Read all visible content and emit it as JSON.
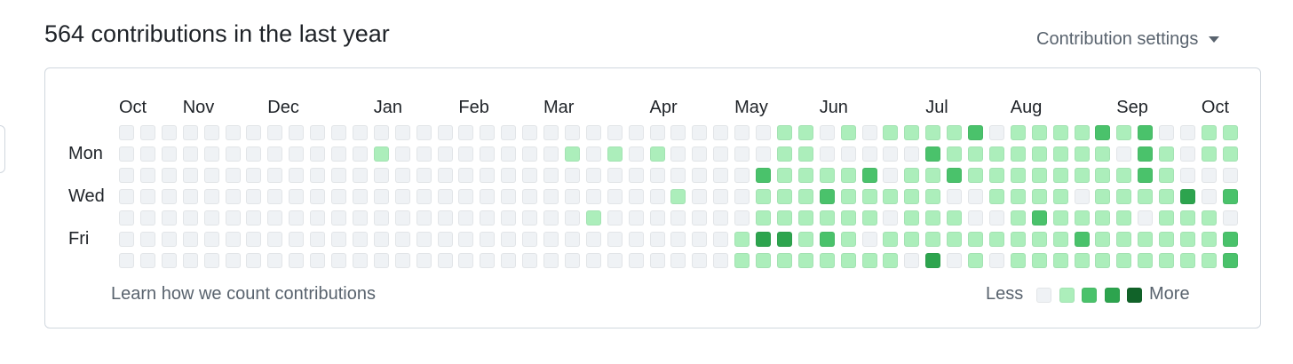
{
  "header": {
    "title": "564 contributions in the last year",
    "settings_label": "Contribution settings",
    "settings_icon": "triangle-down-icon"
  },
  "calendar": {
    "months": [
      "Oct",
      "Nov",
      "Dec",
      "Jan",
      "Feb",
      "Mar",
      "Apr",
      "May",
      "Jun",
      "Jul",
      "Aug",
      "Sep",
      "Oct"
    ],
    "month_week_index": [
      0,
      3,
      7,
      12,
      16,
      20,
      25,
      29,
      33,
      38,
      42,
      47,
      51
    ],
    "day_labels": [
      {
        "label": "Mon",
        "row": 1
      },
      {
        "label": "Wed",
        "row": 3
      },
      {
        "label": "Fri",
        "row": 5
      }
    ],
    "level_colors": [
      "#eff2f5",
      "#aceebb",
      "#4ac26b",
      "#2da44e",
      "#116329"
    ],
    "weeks": [
      [
        0,
        0,
        0,
        0,
        0,
        0,
        0
      ],
      [
        0,
        0,
        0,
        0,
        0,
        0,
        0
      ],
      [
        0,
        0,
        0,
        0,
        0,
        0,
        0
      ],
      [
        0,
        0,
        0,
        0,
        0,
        0,
        0
      ],
      [
        0,
        0,
        0,
        0,
        0,
        0,
        0
      ],
      [
        0,
        0,
        0,
        0,
        0,
        0,
        0
      ],
      [
        0,
        0,
        0,
        0,
        0,
        0,
        0
      ],
      [
        0,
        0,
        0,
        0,
        0,
        0,
        0
      ],
      [
        0,
        0,
        0,
        0,
        0,
        0,
        0
      ],
      [
        0,
        0,
        0,
        0,
        0,
        0,
        0
      ],
      [
        0,
        0,
        0,
        0,
        0,
        0,
        0
      ],
      [
        0,
        0,
        0,
        0,
        0,
        0,
        0
      ],
      [
        0,
        1,
        0,
        0,
        0,
        0,
        0
      ],
      [
        0,
        0,
        0,
        0,
        0,
        0,
        0
      ],
      [
        0,
        0,
        0,
        0,
        0,
        0,
        0
      ],
      [
        0,
        0,
        0,
        0,
        0,
        0,
        0
      ],
      [
        0,
        0,
        0,
        0,
        0,
        0,
        0
      ],
      [
        0,
        0,
        0,
        0,
        0,
        0,
        0
      ],
      [
        0,
        0,
        0,
        0,
        0,
        0,
        0
      ],
      [
        0,
        0,
        0,
        0,
        0,
        0,
        0
      ],
      [
        0,
        0,
        0,
        0,
        0,
        0,
        0
      ],
      [
        0,
        1,
        0,
        0,
        0,
        0,
        0
      ],
      [
        0,
        0,
        0,
        0,
        1,
        0,
        0
      ],
      [
        0,
        1,
        0,
        0,
        0,
        0,
        0
      ],
      [
        0,
        0,
        0,
        0,
        0,
        0,
        0
      ],
      [
        0,
        1,
        0,
        0,
        0,
        0,
        0
      ],
      [
        0,
        0,
        0,
        1,
        0,
        0,
        0
      ],
      [
        0,
        0,
        0,
        0,
        0,
        0,
        0
      ],
      [
        0,
        0,
        0,
        0,
        0,
        0,
        0
      ],
      [
        0,
        0,
        0,
        0,
        0,
        1,
        1
      ],
      [
        0,
        0,
        2,
        1,
        1,
        3,
        1
      ],
      [
        1,
        1,
        1,
        1,
        1,
        3,
        1
      ],
      [
        1,
        1,
        1,
        1,
        1,
        1,
        1
      ],
      [
        0,
        0,
        1,
        2,
        1,
        2,
        1
      ],
      [
        1,
        0,
        1,
        1,
        1,
        1,
        1
      ],
      [
        0,
        0,
        2,
        1,
        1,
        0,
        1
      ],
      [
        1,
        0,
        0,
        1,
        0,
        1,
        1
      ],
      [
        1,
        0,
        1,
        1,
        1,
        1,
        0
      ],
      [
        1,
        2,
        1,
        1,
        1,
        1,
        3
      ],
      [
        1,
        1,
        2,
        0,
        1,
        1,
        0
      ],
      [
        2,
        1,
        1,
        0,
        0,
        1,
        1
      ],
      [
        0,
        1,
        1,
        1,
        0,
        1,
        0
      ],
      [
        1,
        1,
        1,
        1,
        1,
        1,
        1
      ],
      [
        1,
        1,
        1,
        1,
        2,
        1,
        1
      ],
      [
        1,
        1,
        1,
        1,
        1,
        1,
        1
      ],
      [
        1,
        1,
        1,
        0,
        1,
        2,
        1
      ],
      [
        2,
        1,
        1,
        1,
        1,
        1,
        1
      ],
      [
        1,
        0,
        1,
        1,
        1,
        1,
        1
      ],
      [
        2,
        2,
        2,
        1,
        0,
        1,
        1
      ],
      [
        0,
        1,
        1,
        1,
        1,
        1,
        1
      ],
      [
        0,
        0,
        0,
        3,
        1,
        1,
        1
      ],
      [
        1,
        1,
        0,
        0,
        1,
        1,
        1
      ],
      [
        1,
        1,
        0,
        2,
        0,
        2,
        2
      ]
    ]
  },
  "footer": {
    "learn_link": "Learn how we count contributions",
    "legend_less": "Less",
    "legend_more": "More"
  }
}
